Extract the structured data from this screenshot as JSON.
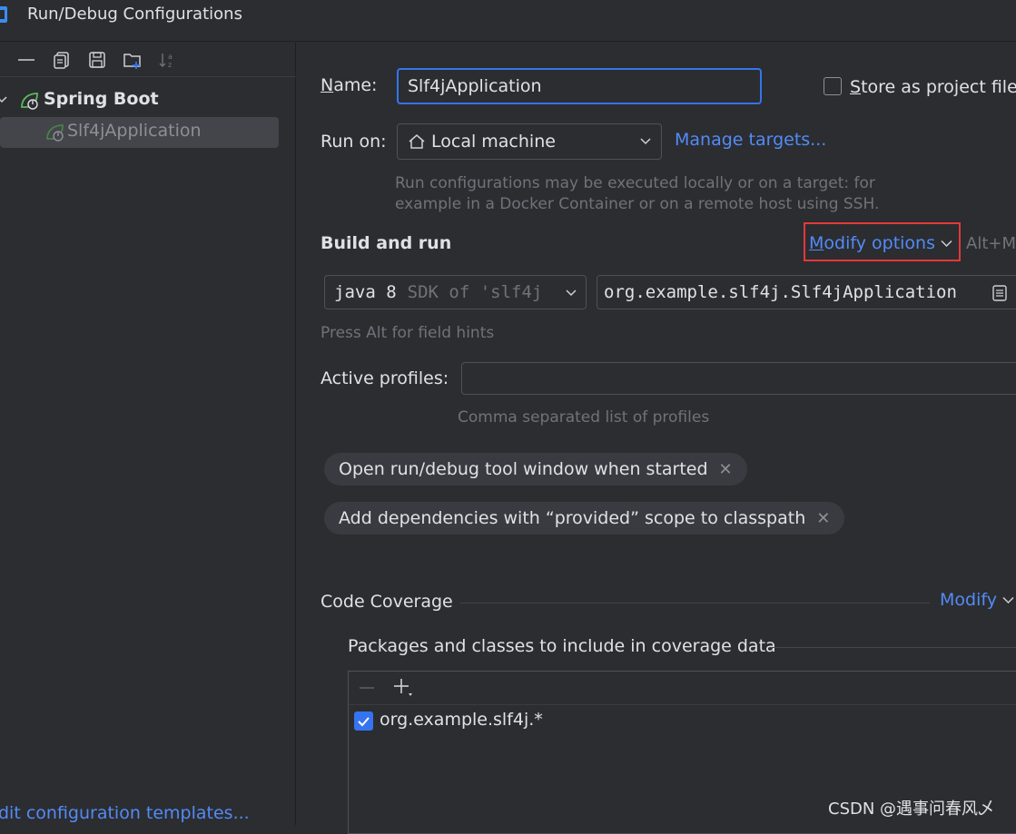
{
  "window": {
    "title": "Run/Debug Configurations"
  },
  "tree": {
    "group_label": "Spring Boot",
    "item_label": "Slf4jApplication"
  },
  "sidebar": {
    "edit_templates_link": "dit configuration templates..."
  },
  "form": {
    "name_label": "Name:",
    "name_label_mnemonic": "N",
    "name_label_rest": "ame:",
    "name_value": "Slf4jApplication",
    "store_label": "Store as project file",
    "store_mnemonic": "S",
    "store_rest": "tore as project file",
    "store_checked": false,
    "run_on_label": "Run on:",
    "run_on_value": "Local machine",
    "manage_targets": "Manage targets...",
    "run_on_hint_line1": "Run configurations may be executed locally or on a target: for",
    "run_on_hint_line2": "example in a Docker Container or on a remote host using SSH."
  },
  "build": {
    "section_title": "Build and run",
    "modify_options": "Modify options",
    "modify_options_mnemonic": "M",
    "modify_options_rest": "odify options",
    "shortcut": "Alt+M",
    "jdk_value": "java 8",
    "jdk_suffix": "SDK of 'slf4j",
    "main_class": "org.example.slf4j.Slf4jApplication",
    "field_hints": "Press Alt for field hints",
    "active_profiles_label": "Active profiles:",
    "active_profiles_value": "",
    "active_profiles_hint": "Comma separated list of profiles",
    "chips": [
      "Open run/debug tool window when started",
      "Add dependencies with “provided” scope to classpath"
    ]
  },
  "coverage": {
    "section_title": "Code Coverage",
    "modify": "Modify",
    "packages_title": "Packages and classes to include in coverage data",
    "entries": [
      {
        "pattern": "org.example.slf4j.*",
        "checked": true
      }
    ]
  },
  "watermark": "CSDN @遇事问春风乄",
  "colors": {
    "background": "#2b2d30",
    "accent": "#3574f0",
    "link": "#548af7",
    "highlight_box": "#e5383b",
    "spring_green": "#5fb85f"
  }
}
